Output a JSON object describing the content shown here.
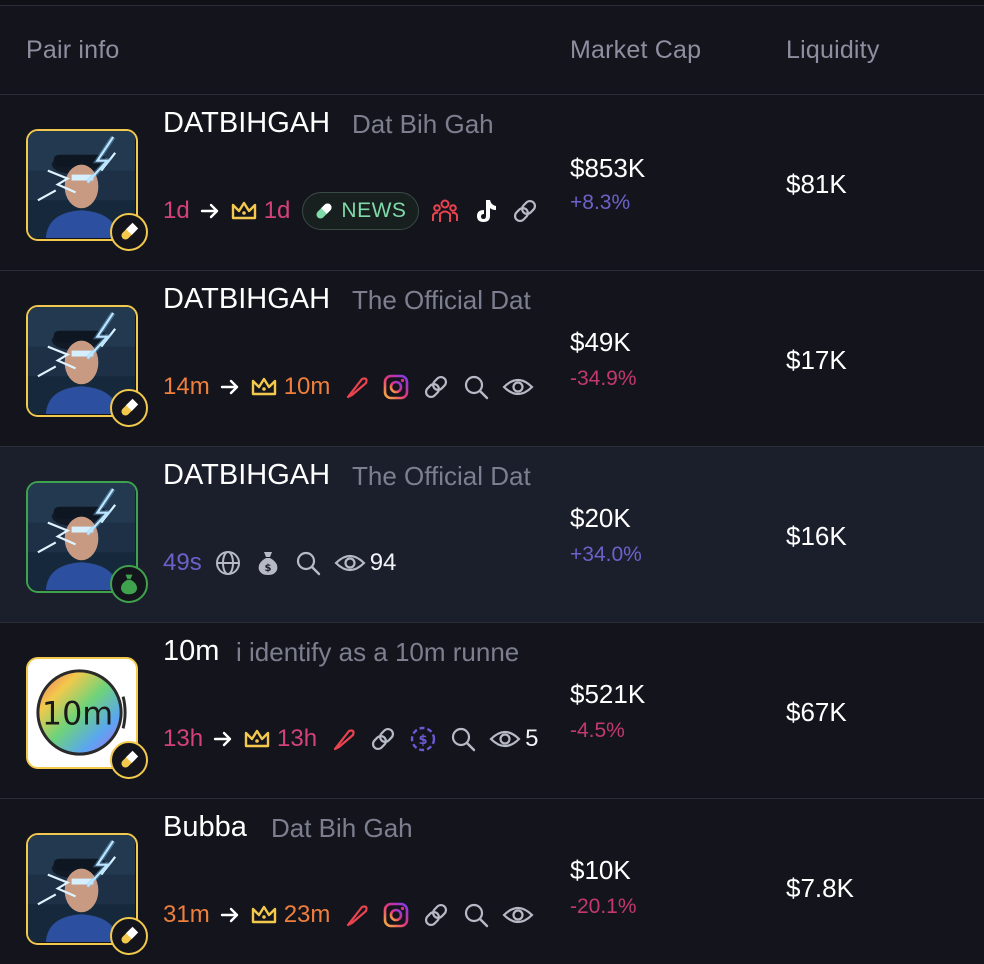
{
  "header": {
    "pair_info": "Pair info",
    "market_cap": "Market Cap",
    "liquidity": "Liquidity"
  },
  "colors": {
    "background": "#14151c",
    "highlight_row": "#1b1f2c",
    "gold_border": "#f2c94c",
    "green_border": "#3fa34d",
    "positive": "#6b62c9",
    "negative": "#c2386f"
  },
  "rows": [
    {
      "symbol": "DATBIHGAH",
      "name": "Dat Bih Gah",
      "age": "1d",
      "crown_age": "1d",
      "news_label": "NEWS",
      "icons": [
        "pill-icon",
        "news-badge",
        "community-icon",
        "tiktok-icon",
        "link-icon"
      ],
      "market_cap": "$853K",
      "change": "+8.3%",
      "liquidity": "$81K"
    },
    {
      "symbol": "DATBIHGAH",
      "name": "The Official Dat",
      "age": "14m",
      "crown_age": "10m",
      "icons": [
        "feather-icon",
        "instagram-icon",
        "link-icon",
        "search-icon",
        "eye-icon"
      ],
      "market_cap": "$49K",
      "change": "-34.9%",
      "liquidity": "$17K"
    },
    {
      "symbol": "DATBIHGAH",
      "name": "The Official Dat",
      "age": "49s",
      "views": "94",
      "icons": [
        "globe-icon",
        "money-bag-icon",
        "search-icon",
        "eye-icon"
      ],
      "market_cap": "$20K",
      "change": "+34.0%",
      "liquidity": "$16K"
    },
    {
      "symbol": "10m",
      "name": "i identify as a 10m runne",
      "age": "13h",
      "crown_age": "13h",
      "views_partial": "5",
      "logo_text": "10m",
      "icons": [
        "feather-icon",
        "link-icon",
        "dollar-coin-icon",
        "search-icon",
        "eye-icon"
      ],
      "market_cap": "$521K",
      "change": "-4.5%",
      "liquidity": "$67K"
    },
    {
      "symbol": "Bubba",
      "name": "Dat Bih Gah",
      "age": "31m",
      "crown_age": "23m",
      "icons": [
        "feather-icon",
        "instagram-icon",
        "link-icon",
        "search-icon",
        "eye-icon"
      ],
      "market_cap": "$10K",
      "change": "-20.1%",
      "liquidity": "$7.8K"
    }
  ]
}
